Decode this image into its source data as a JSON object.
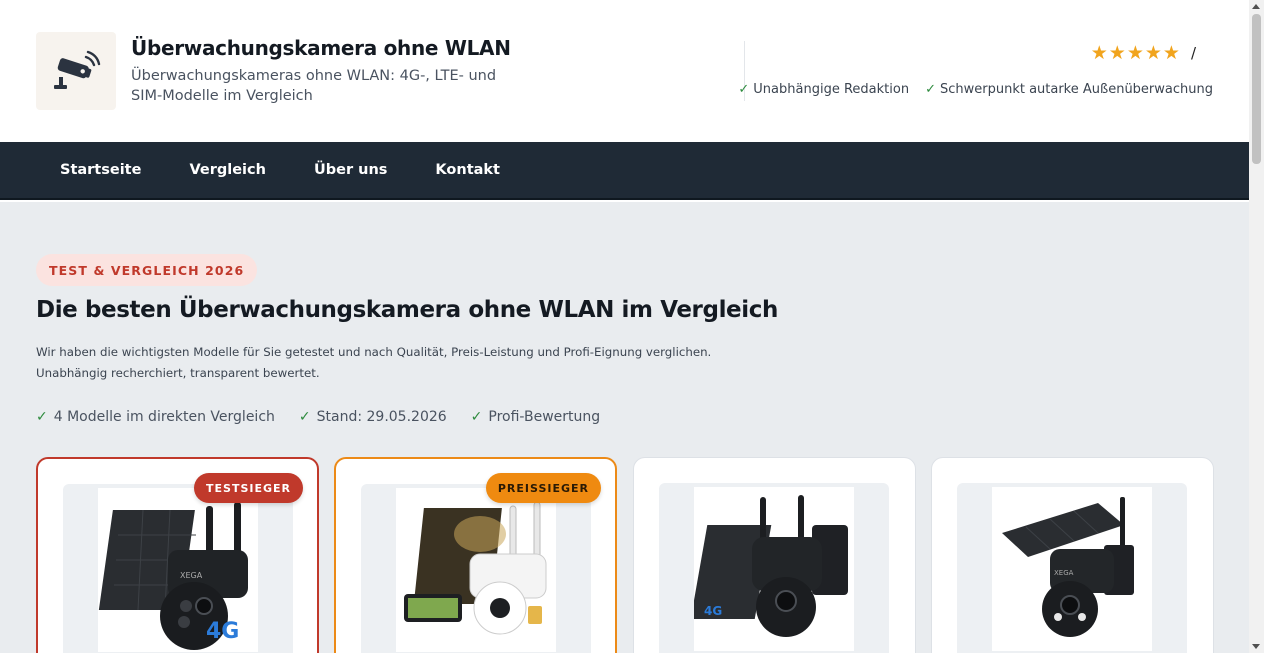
{
  "header": {
    "title": "Überwachungskamera ohne WLAN",
    "tagline": "Überwachungskameras ohne WLAN: 4G-, LTE- und SIM-Modelle im Vergleich",
    "logo_icon": "security-camera-icon",
    "rating_stars": "★★★★★",
    "rating_separator": "/",
    "trust_items": [
      "Unabhängige Redaktion",
      "Schwerpunkt autarke Außenüberwachung"
    ],
    "check_glyph": "✓"
  },
  "nav": {
    "items": [
      "Startseite",
      "Vergleich",
      "Über uns",
      "Kontakt"
    ]
  },
  "hero": {
    "badge": "TEST & VERGLEICH 2026",
    "title": "Die besten Überwachungskamera ohne WLAN im Vergleich",
    "description": "Wir haben die wichtigsten Modelle für Sie getestet und nach Qualität, Preis-Leistung und Profi-Eignung verglichen. Unabhängig recherchiert, transparent bewertet.",
    "checks": [
      "4 Modelle im direkten Vergleich",
      "Stand: 29.05.2026",
      "Profi-Bewertung"
    ]
  },
  "products": [
    {
      "ribbon": "TESTSIEGER",
      "ribbon_color": "#c0392b",
      "border_color": "#c0392b",
      "image": "solar-ptz-camera-black-4g"
    },
    {
      "ribbon": "PREISSIEGER",
      "ribbon_color": "#ef8a10",
      "border_color": "#ec8a17",
      "image": "solar-ptz-camera-white-4g"
    },
    {
      "ribbon": "",
      "image": "solar-ptz-camera-black-wall"
    },
    {
      "ribbon": "",
      "image": "solar-ptz-camera-black-pole"
    }
  ],
  "colors": {
    "nav_bg": "#1f2a36",
    "accent_red": "#c0392b",
    "accent_orange": "#ef8a10",
    "star": "#f1a41d",
    "check": "#2e8b3e",
    "hero_bg": "#e9ecef"
  }
}
